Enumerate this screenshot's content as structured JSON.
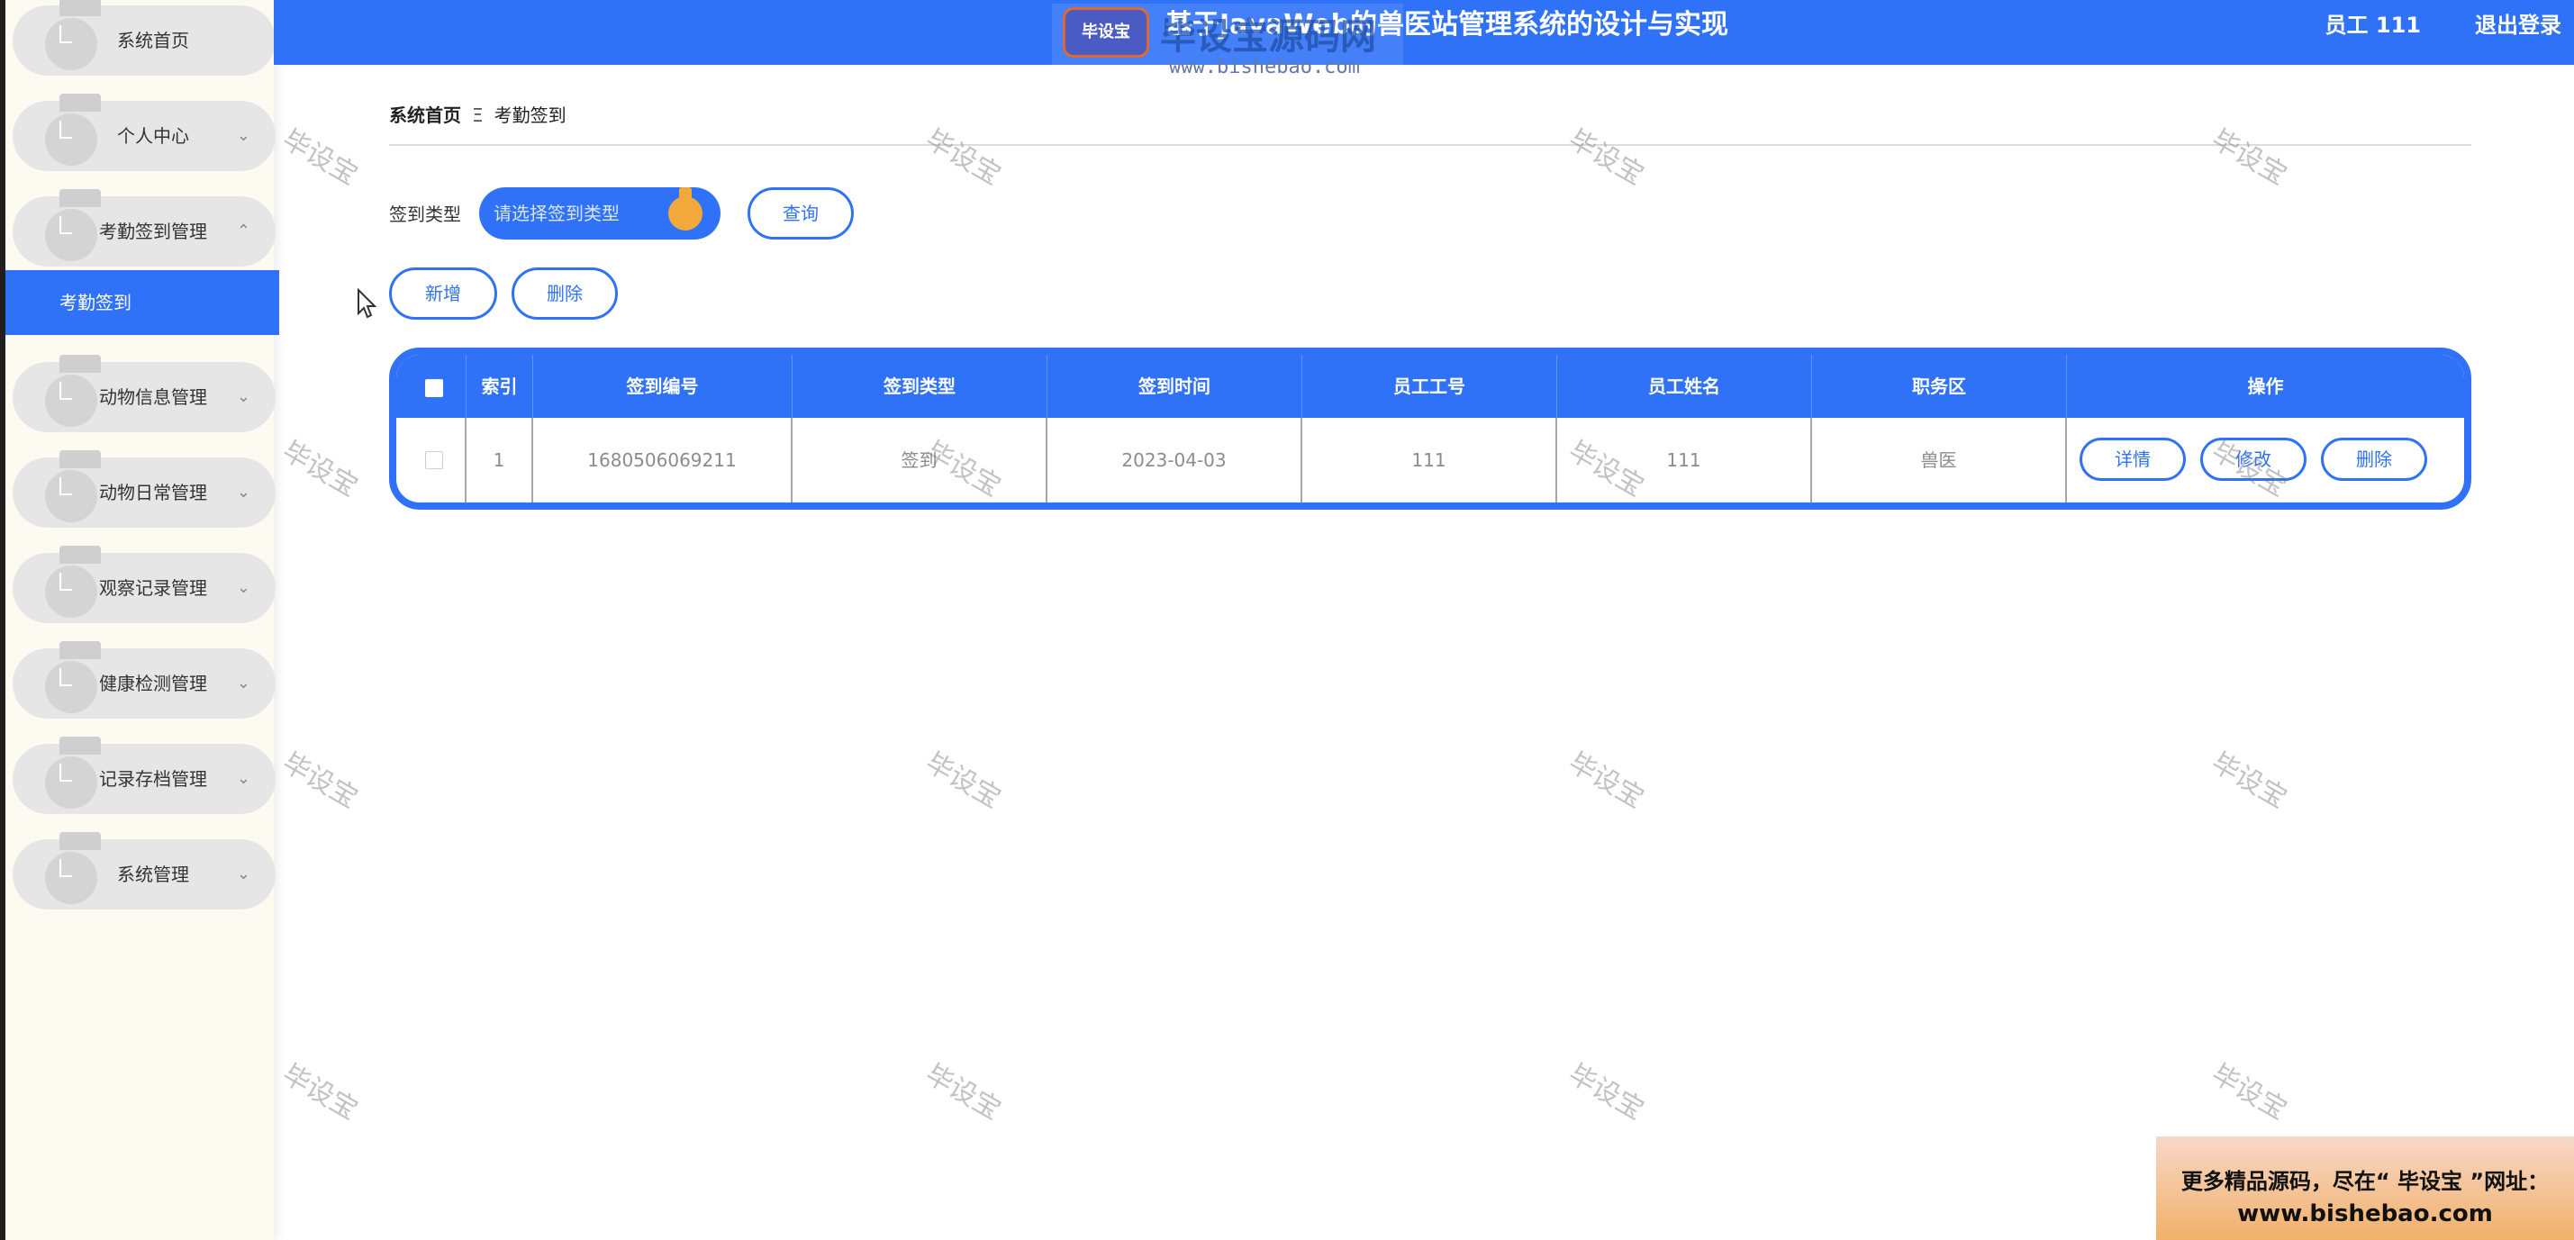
{
  "header": {
    "title": "基于JavaWeb的兽医站管理系统的设计与实现",
    "user": "员工 111",
    "logout": "退出登录",
    "logo_text": "毕设宝源码网",
    "logo_badge": "毕设宝",
    "logo_url": "www.bishebao.com"
  },
  "sidebar": {
    "items": [
      {
        "label": "系统首页",
        "chevron": ""
      },
      {
        "label": "个人中心",
        "chevron": "⌄"
      },
      {
        "label": "考勤签到管理",
        "chevron": "⌃"
      },
      {
        "label": "动物信息管理",
        "chevron": "⌄"
      },
      {
        "label": "动物日常管理",
        "chevron": "⌄"
      },
      {
        "label": "观察记录管理",
        "chevron": "⌄"
      },
      {
        "label": "健康检测管理",
        "chevron": "⌄"
      },
      {
        "label": "记录存档管理",
        "chevron": "⌄"
      },
      {
        "label": "系统管理",
        "chevron": "⌄"
      }
    ],
    "active_sub": "考勤签到"
  },
  "breadcrumb": {
    "home": "系统首页",
    "separator": "Ξ",
    "current": "考勤签到"
  },
  "search": {
    "label": "签到类型",
    "placeholder": "请选择签到类型",
    "query_button": "查询"
  },
  "actions": {
    "add": "新增",
    "delete": "删除"
  },
  "table": {
    "columns": [
      "索引",
      "签到编号",
      "签到类型",
      "签到时间",
      "员工工号",
      "员工姓名",
      "职务区",
      "操作"
    ],
    "rows": [
      {
        "index": "1",
        "code": "1680506069211",
        "type": "签到",
        "time": "2023-04-03",
        "emp_no": "111",
        "emp_name": "111",
        "area": "兽医"
      }
    ],
    "row_buttons": {
      "detail": "详情",
      "edit": "修改",
      "delete": "删除"
    }
  },
  "watermark": "毕设宝",
  "ad": {
    "line1": "更多精品源码，尽在“ 毕设宝 ”网址：",
    "line2": "www.bishebao.com"
  },
  "colors": {
    "primary": "#2f72f7",
    "sidebar_bg": "#fdfaf1",
    "menu_pill": "#e6e6e6",
    "knob": "#f3a83b"
  }
}
